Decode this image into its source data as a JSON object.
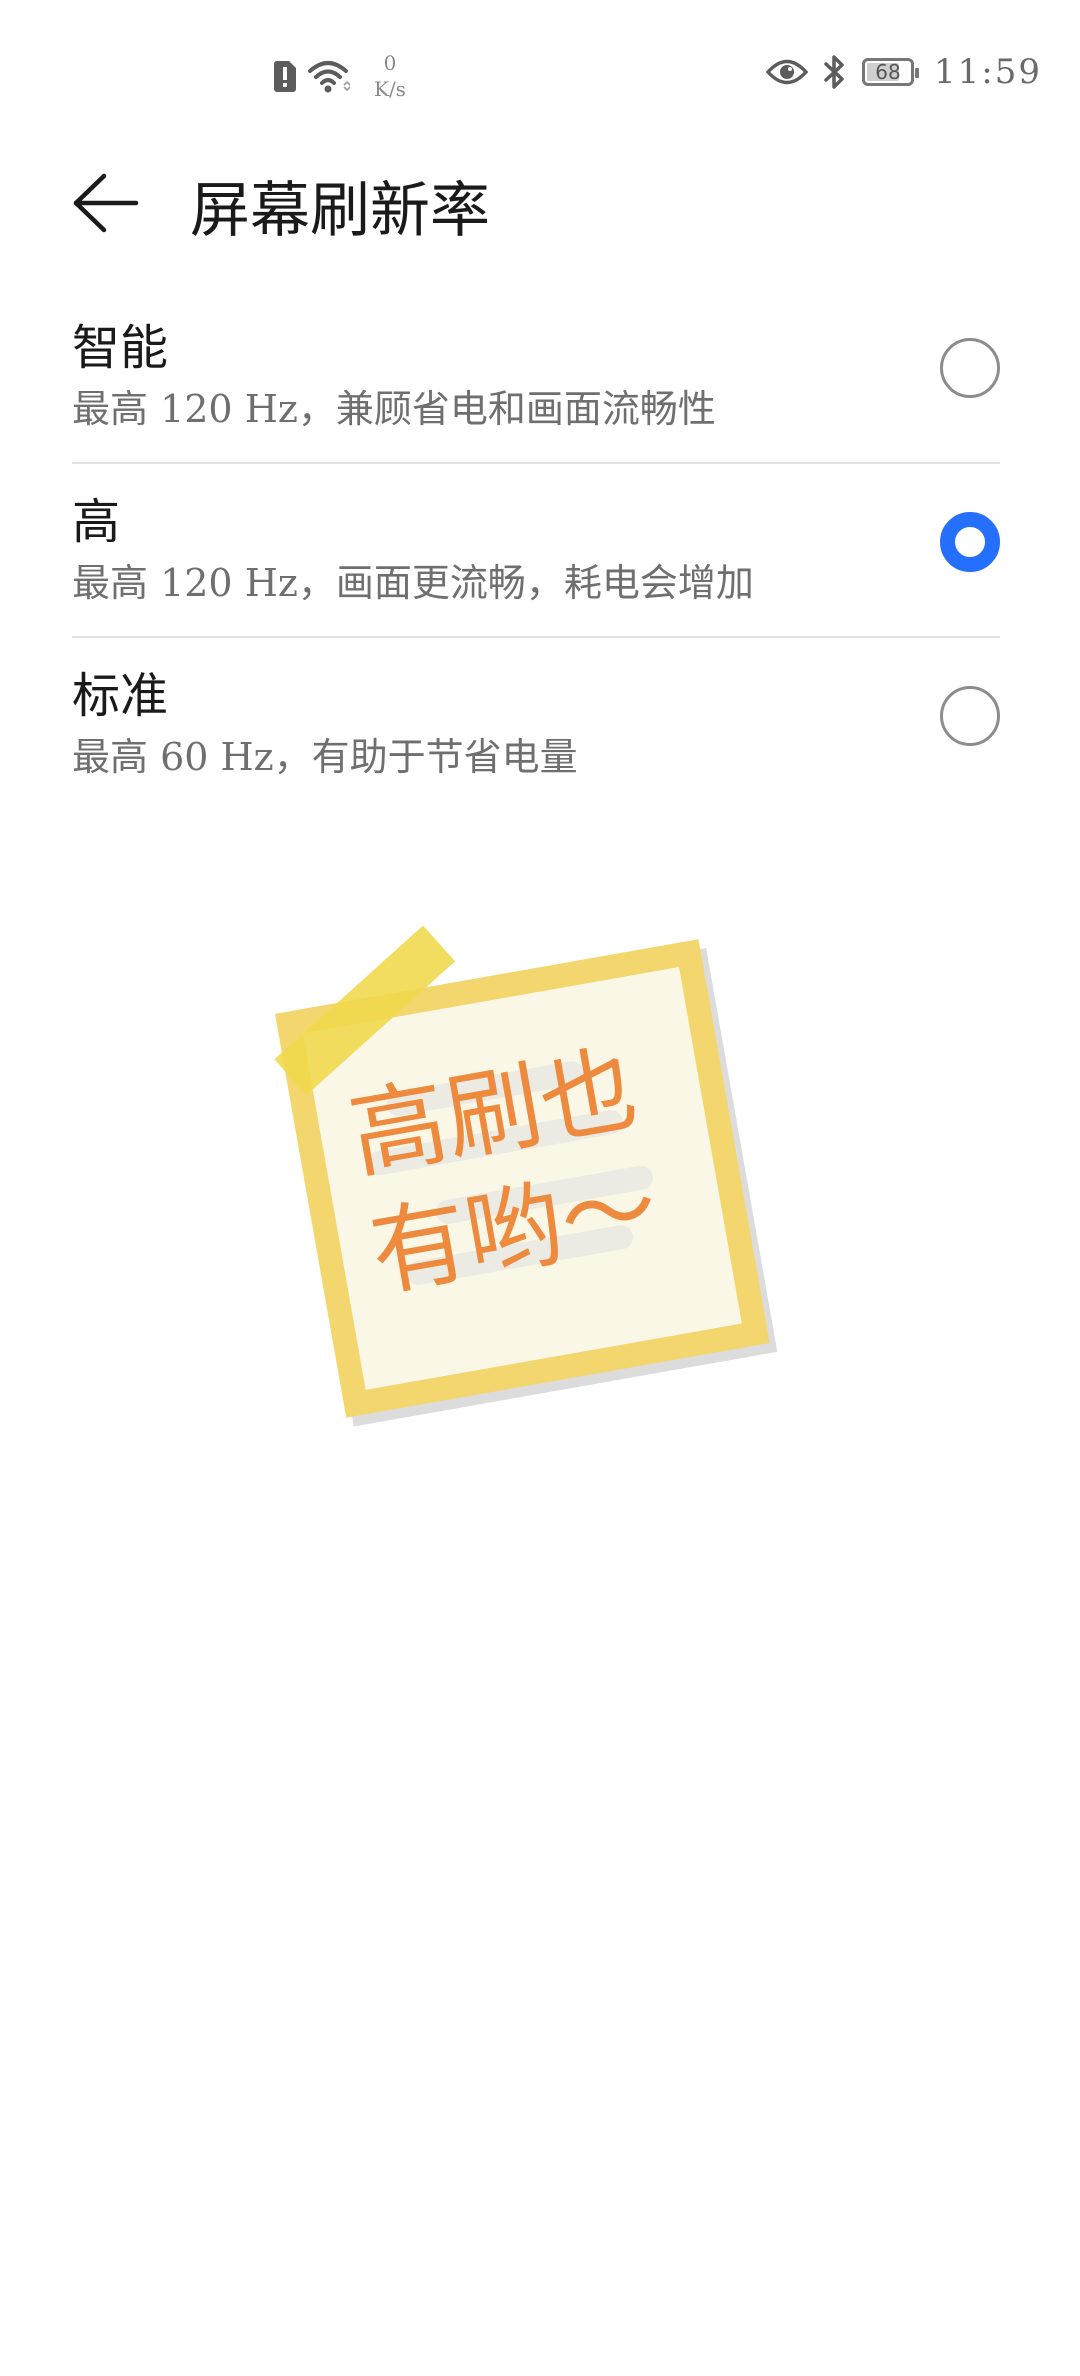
{
  "status_bar": {
    "net_speed_value": "0",
    "net_speed_unit": "K/s",
    "battery_level": "68",
    "time": "11:59",
    "icons": [
      "sim-alert-icon",
      "wifi-icon",
      "eye-comfort-icon",
      "bluetooth-icon",
      "battery-icon"
    ]
  },
  "header": {
    "title": "屏幕刷新率",
    "back_icon": "arrow-left-icon"
  },
  "options": [
    {
      "title": "智能",
      "description": "最高 120 Hz，兼顾省电和画面流畅性",
      "selected": false
    },
    {
      "title": "高",
      "description": "最高 120 Hz，画面更流畅，耗电会增加",
      "selected": true
    },
    {
      "title": "标准",
      "description": "最高 60 Hz，有助于节省电量",
      "selected": false
    }
  ],
  "illustration": {
    "line1": "高刷也",
    "line2": "有哟～"
  },
  "colors": {
    "accent": "#256fff",
    "note_text": "#ee8a3e",
    "note_border": "#f2d46a",
    "tape": "#f0d84a"
  }
}
